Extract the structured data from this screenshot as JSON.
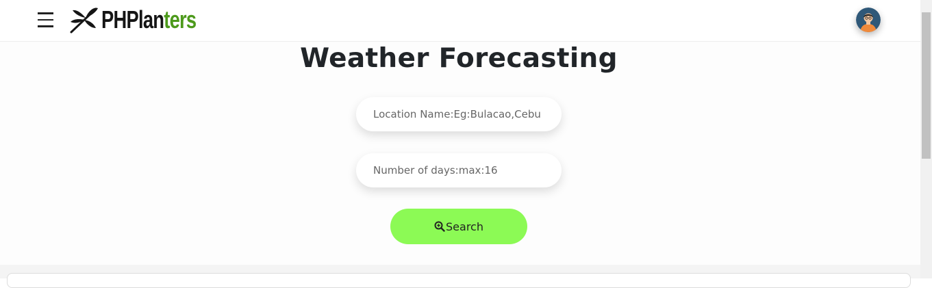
{
  "header": {
    "menu_icon": "hamburger-icon",
    "logo": {
      "text_dark": "PHPlan",
      "text_green": "ters",
      "icon": "dragonfly-icon"
    },
    "avatar_icon": "user-avatar-icon",
    "colors": {
      "logo_dark": "#151515",
      "logo_green": "#4d9a1c"
    }
  },
  "main": {
    "title": "Weather Forecasting",
    "location_input": {
      "placeholder": "Location Name:Eg:Bulacao,Cebu",
      "value": ""
    },
    "days_input": {
      "placeholder": "Number of days:max:16",
      "value": ""
    },
    "search_button": {
      "label": "Search",
      "icon": "zoom-search-icon"
    },
    "colors": {
      "search_button": "#8cfa55",
      "title": "#212529"
    }
  }
}
